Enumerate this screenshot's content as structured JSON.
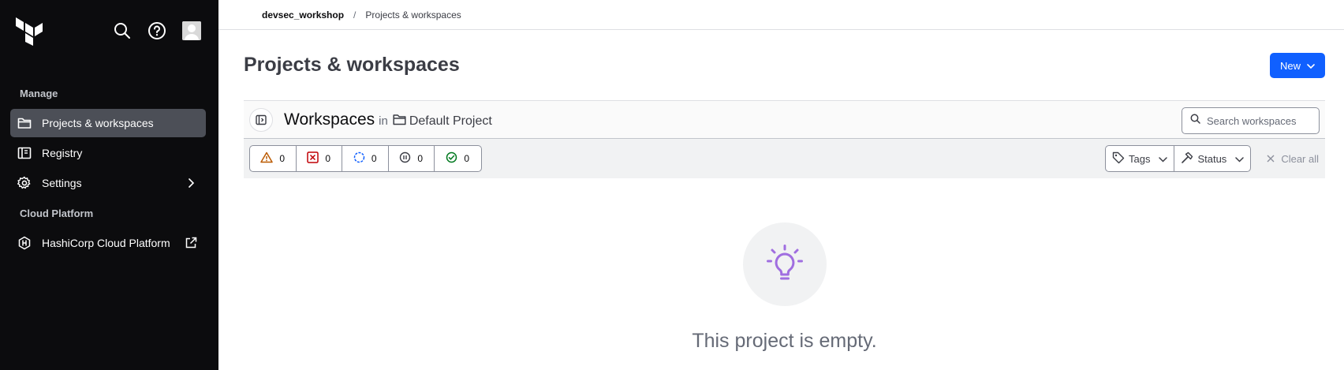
{
  "sidebar": {
    "sections": {
      "manage": "Manage",
      "cloud": "Cloud Platform"
    },
    "items": [
      {
        "label": "Projects & workspaces",
        "icon": "folder-icon"
      },
      {
        "label": "Registry",
        "icon": "registry-icon"
      },
      {
        "label": "Settings",
        "icon": "gear-icon"
      },
      {
        "label": "HashiCorp Cloud Platform",
        "icon": "hcp-icon"
      }
    ]
  },
  "breadcrumb": {
    "org": "devsec_workshop",
    "sep": "/",
    "page": "Projects & workspaces"
  },
  "page": {
    "title": "Projects & workspaces",
    "new_label": "New"
  },
  "workspaces": {
    "title": "Workspaces",
    "in": "in",
    "project": "Default Project",
    "search_placeholder": "Search workspaces"
  },
  "status_counts": {
    "warning": "0",
    "errored": "0",
    "running": "0",
    "paused": "0",
    "success": "0"
  },
  "filters": {
    "tags": "Tags",
    "status": "Status",
    "clear_all": "Clear all"
  },
  "empty": {
    "message": "This project is empty."
  },
  "colors": {
    "accent": "#1060ff",
    "sidebar_bg": "#0c0c0e",
    "warning": "#bb5a00",
    "error": "#c00005",
    "running": "#1060ff",
    "success": "#00781e",
    "bulb": "#a06ee0"
  }
}
